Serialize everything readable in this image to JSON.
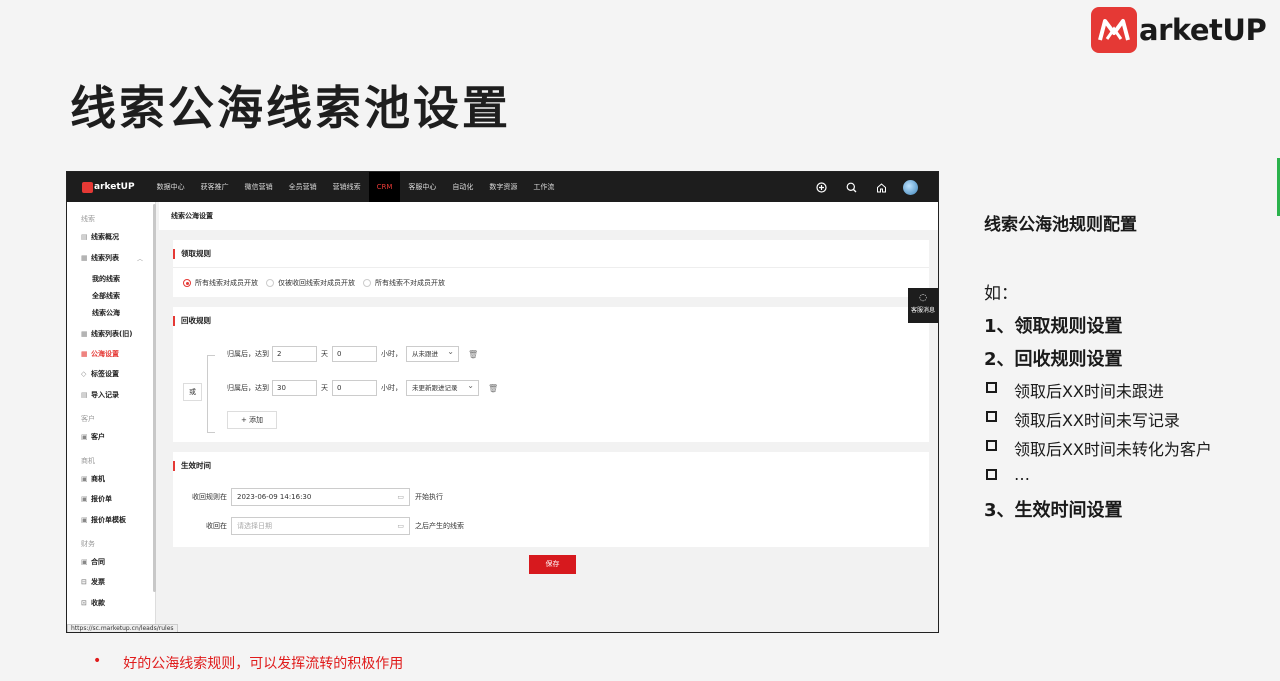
{
  "slide": {
    "logo_text": "arketUP",
    "title": "线索公海线索池设置",
    "bottom_bullet": "•",
    "bottom_note": "好的公海线索规则，可以发挥流转的积极作用"
  },
  "app": {
    "logo_text": "arketUP",
    "nav": [
      "数据中心",
      "获客推广",
      "微信营销",
      "全员营销",
      "营销线索",
      "CRM",
      "客服中心",
      "自动化",
      "数字资源",
      "工作流"
    ],
    "active_nav": "CRM",
    "topbar_icons": [
      "add-circle-icon",
      "search-icon",
      "home-icon",
      "avatar"
    ]
  },
  "sidebar": {
    "group_leads": "线索",
    "leads_overview": "线索概况",
    "leads_list": "线索列表",
    "my_leads": "我的线索",
    "all_leads": "全部线索",
    "leads_pool": "线索公海",
    "leads_list_old": "线索列表(旧)",
    "pool_settings": "公海设置",
    "tag_settings": "标签设置",
    "import_records": "导入记录",
    "group_customer": "客户",
    "customer": "客户",
    "group_opportunity": "商机",
    "opportunity": "商机",
    "quote": "报价单",
    "quote_template": "报价单模板",
    "group_finance": "财务",
    "contract": "合同",
    "invoice": "发票",
    "payment": "收款"
  },
  "status_url": "https://sc.marketup.cn/leads/rules",
  "page": {
    "breadcrumb": "线索公海设置",
    "claim": {
      "title": "领取规则",
      "options": [
        "所有线索对成员开放",
        "仅被收回线索对成员开放",
        "所有线索不对成员开放"
      ],
      "selected": "所有线索对成员开放"
    },
    "recycle": {
      "title": "回收规则",
      "or_label": "或",
      "rules": [
        {
          "prefix": "归属后，达到",
          "days": "2",
          "day_unit": "天",
          "hours": "0",
          "hour_unit": "小时，",
          "condition": "从未跟进"
        },
        {
          "prefix": "归属后，达到",
          "days": "30",
          "day_unit": "天",
          "hours": "0",
          "hour_unit": "小时，",
          "condition": "未更新跟进记录"
        }
      ],
      "add_label": "+ 添加"
    },
    "effective": {
      "title": "生效时间",
      "start_label": "收回规则在",
      "start_value": "2023-06-09 14:16:30",
      "start_suffix": "开始执行",
      "recycle_label": "收回在",
      "recycle_placeholder": "请选择日期",
      "recycle_suffix": "之后产生的线索"
    },
    "save_label": "保存",
    "float_help_label": "客服消息"
  },
  "right_panel": {
    "title": "线索公海池规则配置",
    "intro": "如：",
    "item1": "1、领取规则设置",
    "item2": "2、回收规则设置",
    "sub_items": [
      "领取后XX时间未跟进",
      "领取后XX时间未写记录",
      "领取后XX时间未转化为客户",
      "…"
    ],
    "item3": "3、生效时间设置"
  },
  "colors": {
    "brand_red": "#e53935",
    "save_red": "#d7191e",
    "topbar": "#1d1d1d"
  }
}
